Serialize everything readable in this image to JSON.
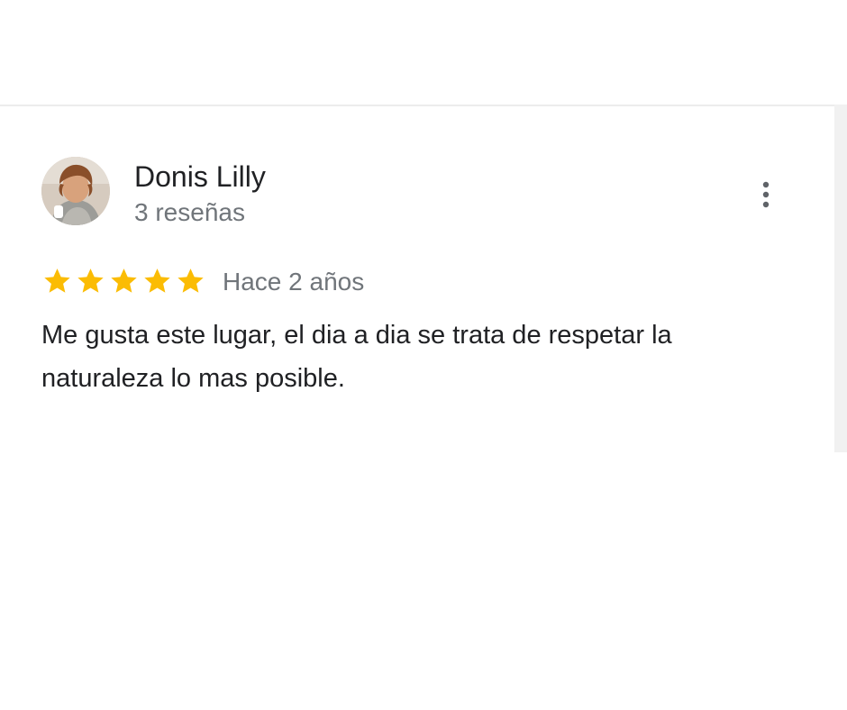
{
  "review": {
    "author_name": "Donis Lilly",
    "review_count": "3 reseñas",
    "rating": 5,
    "rating_max": 5,
    "date": "Hace 2 años",
    "text": "Me gusta este lugar, el dia a dia se trata de respetar la naturaleza lo mas posible."
  },
  "icons": {
    "star": "star-icon",
    "more": "more-vert-icon",
    "avatar": "avatar"
  },
  "colors": {
    "star": "#fbbc04",
    "text_primary": "#202124",
    "text_secondary": "#70757a"
  }
}
